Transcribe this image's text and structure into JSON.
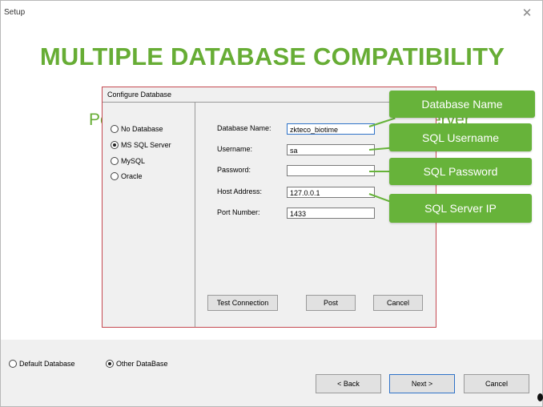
{
  "window": {
    "title": "Setup",
    "close_symbol": "✕"
  },
  "banner": {
    "title": "MULTIPLE DATABASE COMPATIBILITY"
  },
  "background": {
    "left_fragment": "Pe",
    "right_fragment": "erver"
  },
  "dialog": {
    "title": "Configure Database",
    "db_options": [
      {
        "label": "No Database",
        "checked": false
      },
      {
        "label": "MS SQL Server",
        "checked": true
      },
      {
        "label": "MySQL",
        "checked": false
      },
      {
        "label": "Oracle",
        "checked": false
      }
    ],
    "fields": {
      "database_name": {
        "label": "Database Name:",
        "value": "zkteco_biotime"
      },
      "username": {
        "label": "Username:",
        "value": "sa"
      },
      "password": {
        "label": "Password:",
        "value": ""
      },
      "host_address": {
        "label": "Host Address:",
        "value": "127.0.0.1"
      },
      "port_number": {
        "label": "Port Number:",
        "value": "1433"
      }
    },
    "buttons": {
      "test": "Test Connection",
      "post": "Post",
      "cancel": "Cancel"
    }
  },
  "callouts": {
    "database_name": "Database Name",
    "sql_username": "SQL Username",
    "sql_password": "SQL Password",
    "sql_server_ip": "SQL Server IP"
  },
  "bottom": {
    "radios": [
      {
        "label": "Default Database",
        "checked": false
      },
      {
        "label": "Other DataBase",
        "checked": true
      }
    ],
    "buttons": {
      "back": "< Back",
      "next": "Next >",
      "cancel": "Cancel"
    }
  },
  "colors": {
    "accent_green": "#67b33a",
    "dialog_border": "#c54a52",
    "focus_blue": "#2f73c8"
  }
}
